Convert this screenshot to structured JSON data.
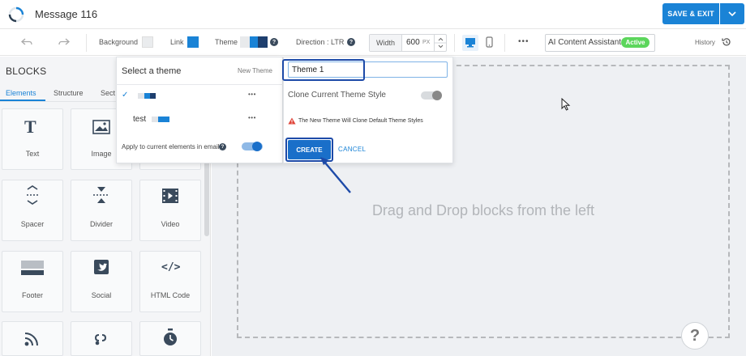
{
  "header": {
    "title": "Message 116",
    "save_label": "SAVE & EXIT"
  },
  "toolbar": {
    "background_label": "Background",
    "link_label": "Link",
    "theme_label": "Theme",
    "direction_label": "Direction : LTR",
    "width_label": "Width",
    "width_value": "600",
    "width_unit": "PX",
    "ai_label": "AI Content Assistant",
    "ai_badge": "Active",
    "history_label": "History"
  },
  "sidebar": {
    "title": "BLOCKS",
    "tabs": [
      "Elements",
      "Structure",
      "Sect"
    ],
    "blocks": [
      "Text",
      "Image",
      "Spacer",
      "Divider",
      "Video",
      "Footer",
      "Social",
      "HTML Code"
    ]
  },
  "theme_panel": {
    "header": "Select a theme",
    "new_theme": "New Theme",
    "themes": [
      {
        "name": "",
        "selected": true
      },
      {
        "name": "test",
        "selected": false
      }
    ],
    "apply_label": "Apply to current elements in email",
    "check_glyph": "✓",
    "more_glyph": "•••"
  },
  "create_panel": {
    "input_value": "Theme 1",
    "clone_label": "Clone Current Theme Style",
    "warning": "The New Theme Will Clone Default Theme Styles",
    "create_label": "CREATE",
    "cancel_label": "CANCEL"
  },
  "canvas": {
    "drop_text": "Drag and Drop blocks from the left",
    "help_glyph": "?"
  },
  "colors": {
    "accent": "#1a83d6",
    "highlight": "#1d4aa8",
    "active_badge": "#5cd65c"
  }
}
